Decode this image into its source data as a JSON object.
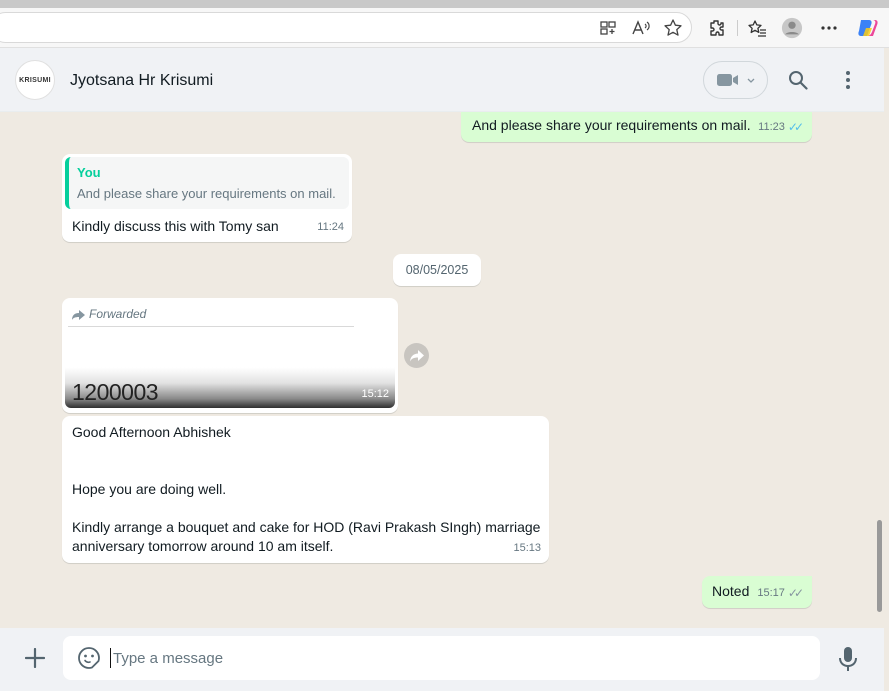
{
  "header": {
    "contact_name": "Jyotsana Hr Krisumi",
    "avatar_text": "KRISUMI"
  },
  "messages": [
    {
      "direction": "out",
      "text": "And please share your requirements on mail.",
      "time": "11:23",
      "status": "read"
    },
    {
      "direction": "in",
      "quote_author": "You",
      "quote_text": "And please share your requirements on mail.",
      "text": "Kindly discuss this with Tomy san",
      "time": "11:24"
    },
    {
      "type": "date",
      "text": "08/05/2025"
    },
    {
      "direction": "in",
      "forwarded_label": "Forwarded",
      "image_text": "1200003",
      "time": "15:12"
    },
    {
      "direction": "in",
      "lines": [
        "Good Afternoon Abhishek",
        "Hope you are doing well.",
        "Kindly arrange a bouquet and cake for HOD (Ravi Prakash SIngh) marriage",
        "anniversary tomorrow around 10 am itself."
      ],
      "time": "15:13"
    },
    {
      "direction": "out",
      "text": "Noted",
      "time": "15:17",
      "status": "delivered"
    }
  ],
  "composer": {
    "placeholder": "Type a message"
  },
  "icons": [
    "reading-view-icon",
    "read-aloud-icon",
    "favorite-star-icon",
    "extensions-icon",
    "favorites-icon",
    "profile-icon",
    "more-icon",
    "copilot-icon",
    "video-call-icon",
    "search-icon",
    "menu-icon",
    "forward-icon",
    "share-icon",
    "plus-icon",
    "sticker-icon",
    "mic-icon"
  ],
  "colors": {
    "outgoing_bubble": "#d9fdd3",
    "incoming_bubble": "#ffffff",
    "chat_background": "#efeae2",
    "accent": "#06cf9c",
    "read_tick": "#53bdeb"
  }
}
